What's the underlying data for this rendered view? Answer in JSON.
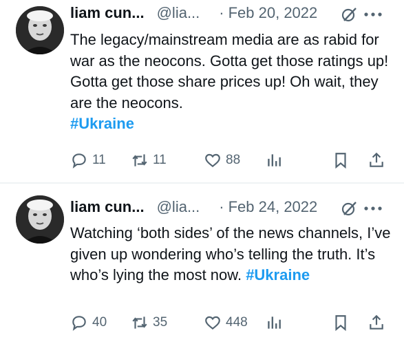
{
  "tweets": [
    {
      "author_name": "liam cun...",
      "handle": "@lia...",
      "separator": "·",
      "date": "Feb 20, 2022",
      "text": "The legacy/mainstream media are as rabid for war as the neocons. Gotta get those ratings up! Gotta get those share prices up! Oh wait, they are the neocons.",
      "hashtag": "#Ukraine",
      "replies": "11",
      "reposts": "11",
      "likes": "88"
    },
    {
      "author_name": "liam cun...",
      "handle": "@lia...",
      "separator": "·",
      "date": "Feb 24, 2022",
      "text": "Watching ‘both sides’ of the news channels, I’ve given up wondering who’s telling the truth. It’s who’s lying the most now.",
      "hashtag": "#Ukraine",
      "replies": "40",
      "reposts": "35",
      "likes": "448"
    }
  ],
  "icons": {
    "reply": "reply-icon",
    "repost": "repost-icon",
    "like": "like-icon",
    "views": "views-icon",
    "bookmark": "bookmark-icon",
    "share": "share-icon",
    "grok": "grok-icon",
    "more": "more-icon"
  },
  "colors": {
    "text": "#0f1419",
    "secondary": "#536471",
    "hashtag": "#1d9bf0",
    "divider": "#eff3f4"
  }
}
